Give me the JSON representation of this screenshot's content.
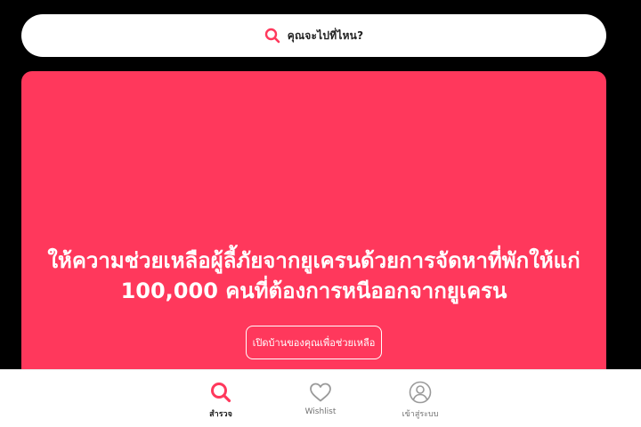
{
  "search": {
    "label": "คุณจะไปที่ไหน?",
    "icon": "search-icon",
    "accent_color": "#ff385c"
  },
  "hero": {
    "heading": "ให้ความช่วยเหลือผู้ลี้ภัยจากยูเครนด้วยการจัดหาที่พักให้แก่ 100,000 คนที่ต้องการหนีออกจากยูเครน",
    "button_label": "เปิดบ้านของคุณเพื่อช่วยเหลือ",
    "background_color": "#ff385c"
  },
  "bottom_nav": {
    "items": [
      {
        "label": "สำรวจ",
        "icon": "search-icon",
        "active": true
      },
      {
        "label": "Wishlist",
        "icon": "heart-icon",
        "active": false
      },
      {
        "label": "เข้าสู่ระบบ",
        "icon": "user-circle-icon",
        "active": false
      }
    ]
  }
}
